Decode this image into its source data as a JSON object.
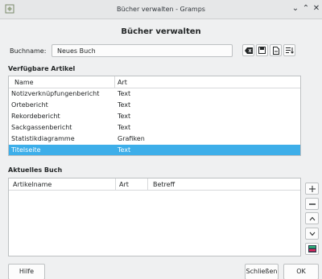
{
  "window": {
    "title": "Bücher verwalten - Gramps"
  },
  "dialog": {
    "title": "Bücher verwalten"
  },
  "bookname": {
    "label": "Buchname:",
    "value": "Neues Buch"
  },
  "available": {
    "heading": "Verfügbare Artikel",
    "columns": [
      "Name",
      "Art"
    ],
    "rows": [
      {
        "name": "Notizverknüpfungenbericht",
        "type": "Text"
      },
      {
        "name": "Ortebericht",
        "type": "Text"
      },
      {
        "name": "Rekordebericht",
        "type": "Text"
      },
      {
        "name": "Sackgassenbericht",
        "type": "Text"
      },
      {
        "name": "Statistikdiagramme",
        "type": "Grafiken"
      },
      {
        "name": "Titelseite",
        "type": "Text"
      }
    ]
  },
  "current": {
    "heading": "Aktuelles Buch",
    "columns": [
      "Artikelname",
      "Art",
      "Betreff"
    ]
  },
  "buttons": {
    "help": "Hilfe",
    "close": "Schließen",
    "ok": "OK"
  }
}
